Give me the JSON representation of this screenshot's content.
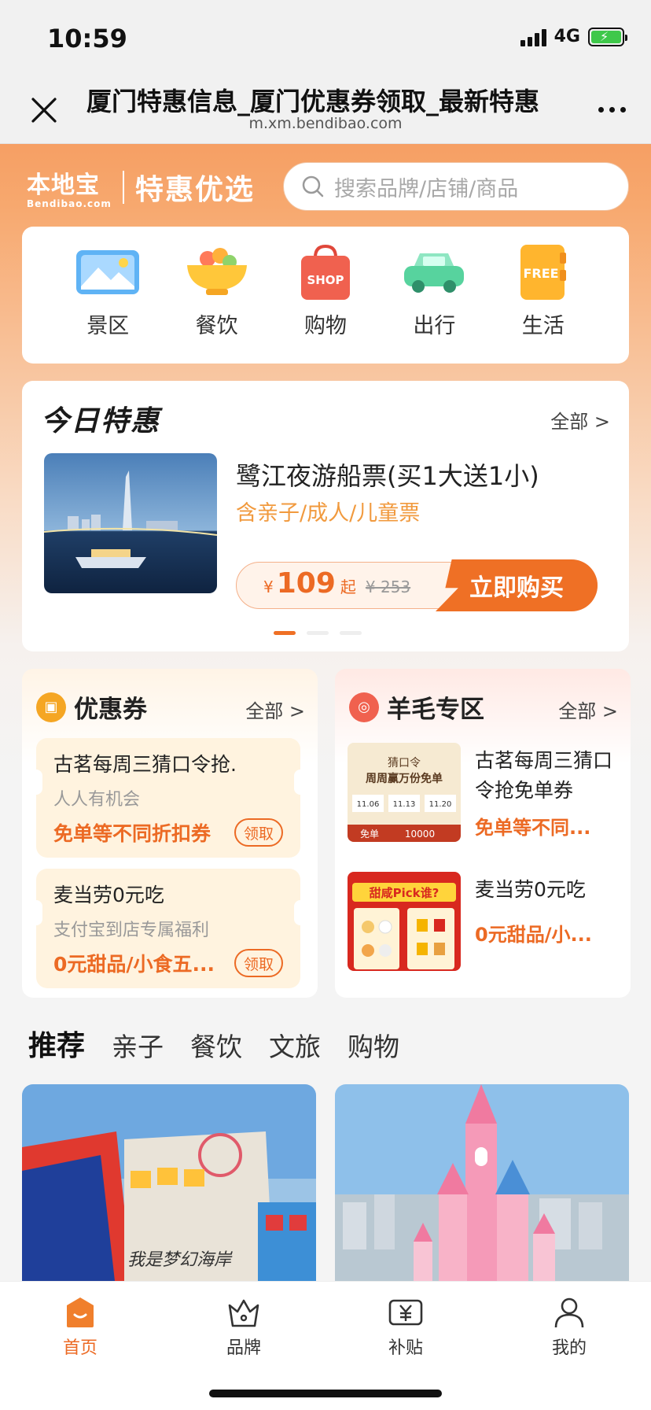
{
  "status": {
    "time": "10:59",
    "network": "4G"
  },
  "browser": {
    "title": "厦门特惠信息_厦门优惠券领取_最新特惠",
    "url": "m.xm.bendibao.com"
  },
  "header": {
    "logo_cn": "本地宝",
    "logo_en": "Bendibao.com",
    "slogan": "特惠优选",
    "search_placeholder": "搜索品牌/店铺/商品"
  },
  "categories": [
    {
      "label": "景区",
      "icon": "scenic-icon"
    },
    {
      "label": "餐饮",
      "icon": "food-bowl-icon"
    },
    {
      "label": "购物",
      "icon": "shopping-bag-icon"
    },
    {
      "label": "出行",
      "icon": "car-icon"
    },
    {
      "label": "生活",
      "icon": "free-notebook-icon"
    }
  ],
  "today": {
    "title": "今日特惠",
    "all": "全部 >",
    "deal": {
      "name": "鹭江夜游船票(买1大送1小)",
      "sub": "含亲子/成人/儿童票",
      "currency": "¥",
      "price": "109",
      "from": "起",
      "original": "¥ 253",
      "buy": "立即购买"
    },
    "carousel_active": 1,
    "carousel_count": 3
  },
  "coupons": {
    "title": "优惠券",
    "all": "全部 >",
    "items": [
      {
        "title": "古茗每周三猜口令抢.",
        "sub": "人人有机会",
        "deal": "免单等不同折扣券",
        "button": "领取"
      },
      {
        "title": "麦当劳0元吃",
        "sub": "支付宝到店专属福利",
        "deal": "0元甜品/小食五...",
        "button": "领取"
      }
    ]
  },
  "yangmao": {
    "title": "羊毛专区",
    "all": "全部 >",
    "items": [
      {
        "title": "古茗每周三猜口令抢免单券",
        "deal": "免单等不同..."
      },
      {
        "title": "麦当劳0元吃",
        "deal": "0元甜品/小..."
      }
    ],
    "poster1": {
      "line1": "猜口令",
      "line2": "周周赢万份免单",
      "d1": "11.06",
      "d2": "11.13",
      "d3": "11.20",
      "free": "免单",
      "count": "10000"
    },
    "poster2": {
      "headline": "甜咸Pick谁?"
    }
  },
  "tabs": [
    "推荐",
    "亲子",
    "餐饮",
    "文旅",
    "购物"
  ],
  "feed": {
    "card1_sign": "我是梦幻海岸"
  },
  "bottom_nav": [
    "首页",
    "品牌",
    "补贴",
    "我的"
  ],
  "colors": {
    "accent": "#ef7025",
    "price": "#ec6a24",
    "header": "#f38a4c"
  }
}
